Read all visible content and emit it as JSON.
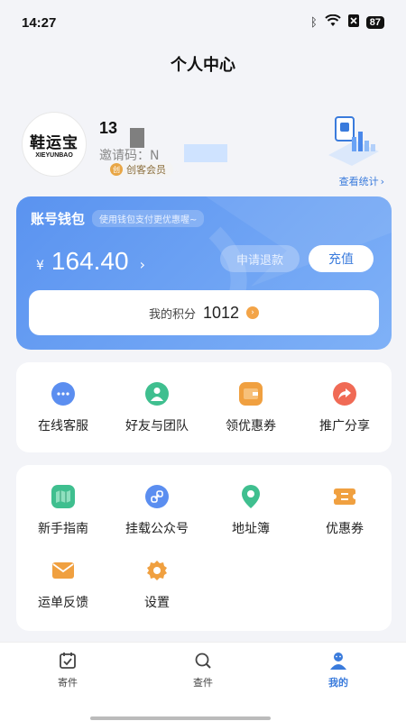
{
  "status_bar": {
    "time": "14:27",
    "battery": "87",
    "bluetooth_icon": "bluetooth-icon",
    "wifi_icon": "wifi-icon"
  },
  "page": {
    "title": "个人中心"
  },
  "profile": {
    "avatar_logo_cn": "鞋运宝",
    "avatar_logo_en": "XIEYUNBAO",
    "phone": "13",
    "invite_label": "邀请码：N",
    "membership": "创客会员",
    "stats_link": "查看统计"
  },
  "wallet": {
    "title": "账号钱包",
    "tip": "使用钱包支付更优惠喔~",
    "currency": "¥",
    "balance": "164.40",
    "refund_label": "申请退款",
    "recharge_label": "充值",
    "points_label": "我的积分",
    "points_value": "1012"
  },
  "services": [
    {
      "label": "在线客服",
      "icon": "chat-icon"
    },
    {
      "label": "好友与团队",
      "icon": "user-icon"
    },
    {
      "label": "领优惠券",
      "icon": "wallet-icon"
    },
    {
      "label": "推广分享",
      "icon": "share-icon"
    }
  ],
  "tools": [
    {
      "label": "新手指南",
      "icon": "map-icon"
    },
    {
      "label": "挂载公众号",
      "icon": "link-icon"
    },
    {
      "label": "地址簿",
      "icon": "location-icon"
    },
    {
      "label": "优惠券",
      "icon": "ticket-icon"
    },
    {
      "label": "运单反馈",
      "icon": "mail-icon"
    },
    {
      "label": "设置",
      "icon": "gear-icon"
    }
  ],
  "tabbar": [
    {
      "label": "寄件",
      "icon": "clipboard-check-icon",
      "active": false
    },
    {
      "label": "查件",
      "icon": "search-icon",
      "active": false
    },
    {
      "label": "我的",
      "icon": "profile-icon",
      "active": true
    }
  ],
  "colors": {
    "accent": "#3a7bdc",
    "wallet_start": "#5a93f0",
    "wallet_end": "#7fb1f7",
    "background": "#f3f4f8"
  }
}
